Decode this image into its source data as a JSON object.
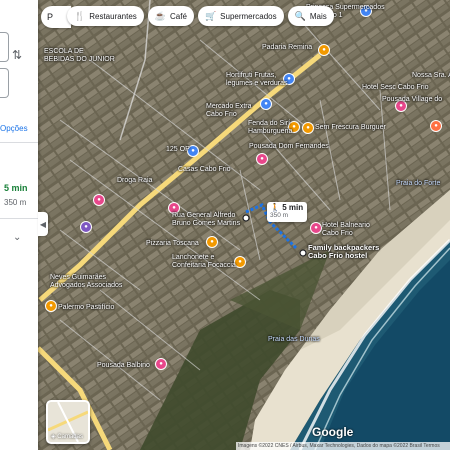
{
  "panel": {
    "options_label": "Opções",
    "time": "5 min",
    "distance": "350 m",
    "swap_icon": "swap-vertical-icon",
    "chevron_icon": "chevron-down-icon"
  },
  "search": {
    "text": "P"
  },
  "chips": [
    {
      "icon": "fork-knife-icon",
      "glyph": "🍴",
      "label": "Restaurantes"
    },
    {
      "icon": "coffee-icon",
      "glyph": "☕",
      "label": "Café"
    },
    {
      "icon": "cart-icon",
      "glyph": "🛒",
      "label": "Supermercados"
    },
    {
      "icon": "search-icon",
      "glyph": "🔍",
      "label": "Mais"
    }
  ],
  "route": {
    "time": "5 min",
    "distance": "350 m",
    "walk_icon": "walking-icon"
  },
  "places": {
    "padaria": "Padaria Remina",
    "hortifruti": "Hortifruti Frutas,\nlegumes e verduras",
    "mercado": "Mercado Extra\nCabo Frio",
    "fenda": "Fenda do Sirí\nHamburgueria",
    "sem_frescura": "Sem Frescura Burguer",
    "pousada_dom": "Pousada Dom Fernandes",
    "hotel_sesc": "Hotel Sesc Cabo Frio",
    "pousada_vila": "Pousada Village do",
    "supermercados": "Princesa Supermercados\nCabo Frio 1",
    "praia_forte": "Praia do Forte",
    "hotel_balneario": "Hotel Balneario\nCabo Frio",
    "family": "Family backpackers\nCabo Frio hostel",
    "rua_general": "Rua General Alfredo\nBruno Gomes Martins",
    "pizzaria": "Pizzaria Toscana",
    "lanchonete": "Lanchonete e\nConfeitaria Focaccia",
    "drogaraia": "Droga Raia",
    "casas": "Casas Cabo Frio",
    "praia_dunas": "Praia das Dunas",
    "pousada_balbino": "Pousada Balbino",
    "palermo": "Palermo Pastifício",
    "neves": "Neves Guimarães\nAdvogados Associados",
    "camara": "Câmara de\nDos Associados",
    "escola": "ESCOLA DE\nBEBIDAS DO JUNIOR",
    "faculdade": "Faculdade de Cabo Frio",
    "cartorio": "125 OP",
    "bairro": "Nossa Sra. Apare"
  },
  "layer": {
    "label": "Camadas"
  },
  "branding": {
    "google": "Google"
  },
  "attribution": "Imagens ©2022 CNES / Airbus, Maxar Technologies, Dados do mapa ©2022   Brasil   Termos"
}
